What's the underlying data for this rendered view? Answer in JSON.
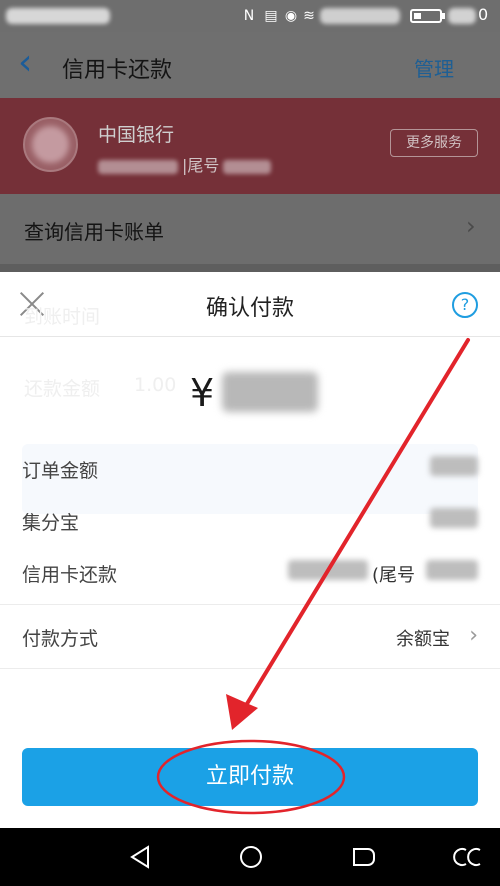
{
  "header": {
    "back_icon": "chevron-left-icon",
    "title": "信用卡还款",
    "manage_label": "管理"
  },
  "bank_card": {
    "bank_name": "中国银行",
    "tail_prefix": "|",
    "tail_label": "尾号",
    "more_services_label": "更多服务"
  },
  "query_bill": {
    "label": "查询信用卡账单"
  },
  "background_ghost": {
    "line1": "到账时间",
    "line2": "还款金额",
    "line2_value": "1.00"
  },
  "dialog": {
    "title": "确认付款",
    "close_icon": "close-icon",
    "help_icon": "help-icon",
    "help_glyph": "?",
    "currency_symbol": "¥",
    "rows": [
      {
        "label": "订单金额"
      },
      {
        "label": "集分宝"
      },
      {
        "label": "信用卡还款",
        "tail_text": "(尾号"
      },
      {
        "label": "付款方式",
        "value": "余额宝"
      }
    ],
    "pay_button_label": "立即付款"
  },
  "annotation": {
    "color": "#e2242b"
  },
  "nav": {
    "back_icon": "triangle-back-icon",
    "home_icon": "circle-home-icon",
    "recent_icon": "recent-apps-icon",
    "extra_icon": "double-circle-icon"
  }
}
